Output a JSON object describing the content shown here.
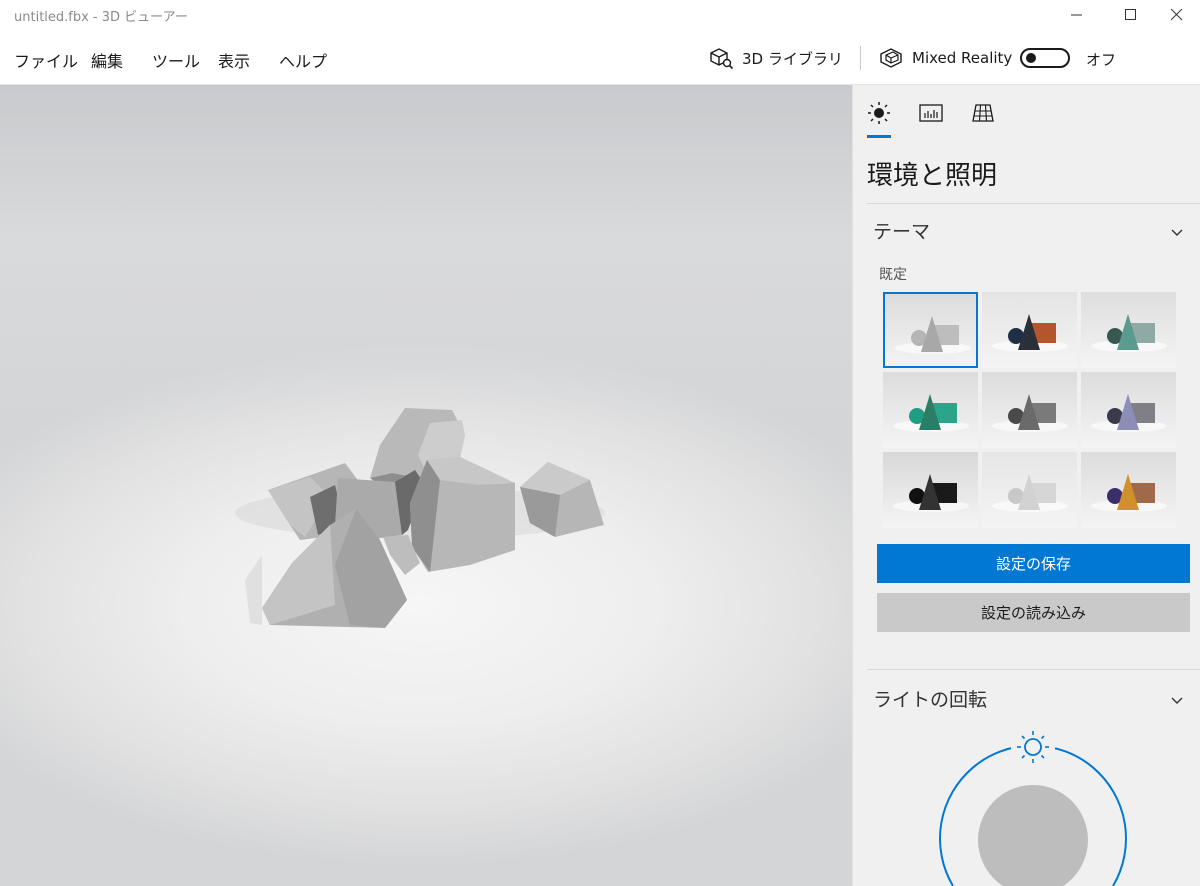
{
  "window": {
    "title": "untitled.fbx - 3D ビューアー"
  },
  "menu": {
    "items": [
      "ファイル",
      "編集",
      "ツール",
      "表示",
      "ヘルプ"
    ],
    "library_label": "3D ライブラリ",
    "mixed_reality_label": "Mixed Reality",
    "mixed_reality_state": "オフ"
  },
  "panel": {
    "tabs": [
      "sun-icon",
      "stats-icon",
      "grid-icon"
    ],
    "title": "環境と照明",
    "theme_section": {
      "heading": "テーマ",
      "sub_label": "既定",
      "selected_index": 0,
      "themes": [
        {
          "ball": "#b5b5b5",
          "cone": "#a8a8a8",
          "box": "#bdbdbd",
          "bg": "#dcdcdc"
        },
        {
          "ball": "#1f2f44",
          "cone": "#2a2f3a",
          "box": "#b4552e",
          "bg": "#e4e4e4"
        },
        {
          "ball": "#37574f",
          "cone": "#5a9a8f",
          "box": "#8fa9a4",
          "bg": "#dedede"
        },
        {
          "ball": "#1f9e84",
          "cone": "#2a7d66",
          "box": "#2aa58a",
          "bg": "#dcdcdc"
        },
        {
          "ball": "#4a4a4a",
          "cone": "#6a6a6a",
          "box": "#7a7a7a",
          "bg": "#dcdcdc"
        },
        {
          "ball": "#3a3a4a",
          "cone": "#8b8fb8",
          "box": "#7f7f85",
          "bg": "#dcdcdc"
        },
        {
          "ball": "#111111",
          "cone": "#333333",
          "box": "#1a1a1a",
          "bg": "#d8d8d8"
        },
        {
          "ball": "#c8c8c8",
          "cone": "#d2d2d2",
          "box": "#d6d6d6",
          "bg": "#e6e6e6"
        },
        {
          "ball": "#3a2f6a",
          "cone": "#d0902c",
          "box": "#a06a4a",
          "bg": "#dcdcdc"
        }
      ]
    },
    "save_label": "設定の保存",
    "load_label": "設定の読み込み",
    "light_section": {
      "heading": "ライトの回転"
    }
  },
  "colors": {
    "accent": "#0078d4"
  }
}
